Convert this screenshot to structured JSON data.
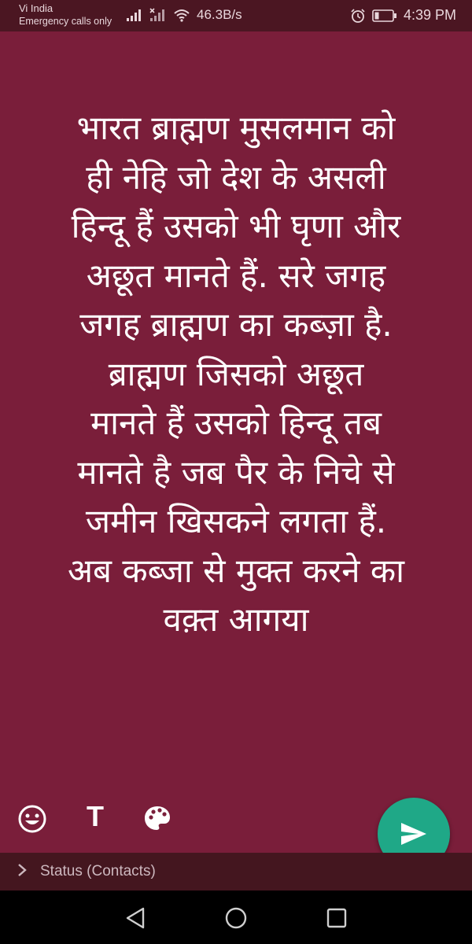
{
  "status_bar": {
    "carrier": "Vi India",
    "carrier_sub": "Emergency calls only",
    "net_speed": "46.3B/s",
    "time": "4:39 PM",
    "icons": [
      "signal-icon",
      "no-signal-icon",
      "wifi-icon",
      "alarm-icon",
      "battery-icon"
    ]
  },
  "composer": {
    "background_color": "#7a1e3a",
    "text": "भारत ब्राह्मण मुसलमान को\nही नेहि जो देश के असली\nहिन्दू हैं उसको भी घृणा और\nअछूत मानते हैं. सरे जगह\nजगह ब्राह्मण का कब्ज़ा है.\nब्राह्मण जिसको अछूत\nमानते हैं उसको हिन्दू तब\nमानते है जब पैर के निचे से\nजमीन खिसकने लगता हैं.\nअब कब्जा से मुक्त करने का\nवक़्त आगया",
    "tools": {
      "emoji": "emoji-icon",
      "text_label": "T",
      "palette": "palette-icon"
    },
    "send": "send-icon",
    "send_color": "#1fa887"
  },
  "audience": {
    "label": "Status (Contacts)"
  },
  "nav": [
    "back-icon",
    "home-icon",
    "recents-icon"
  ]
}
